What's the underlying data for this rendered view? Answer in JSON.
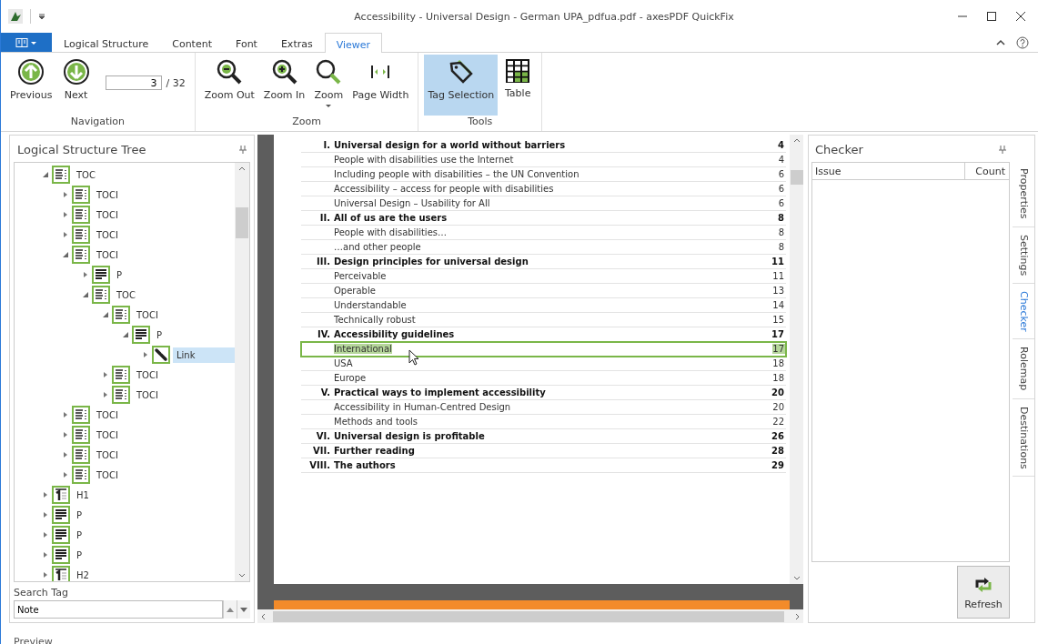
{
  "window": {
    "title": "Accessibility - Universal Design - German UPA_pdfua.pdf - axesPDF QuickFix"
  },
  "ribbon_tabs": [
    {
      "label": "Logical Structure",
      "selected": false
    },
    {
      "label": "Content",
      "selected": false
    },
    {
      "label": "Font",
      "selected": false
    },
    {
      "label": "Extras",
      "selected": false
    },
    {
      "label": "Viewer",
      "selected": true
    }
  ],
  "ribbon_groups": [
    {
      "label": "Navigation",
      "items": [
        {
          "kind": "previous",
          "label": "Previous",
          "selected": false
        },
        {
          "kind": "next",
          "label": "Next",
          "selected": false
        },
        {
          "kind": "page_field",
          "value": "3",
          "total": "/ 32"
        }
      ]
    },
    {
      "label": "Zoom",
      "items": [
        {
          "kind": "zoom_out",
          "label": "Zoom Out",
          "selected": false
        },
        {
          "kind": "zoom_in",
          "label": "Zoom In",
          "selected": false
        },
        {
          "kind": "zoom",
          "label": "Zoom",
          "selected": false
        },
        {
          "kind": "page_width",
          "label": "Page Width",
          "selected": false
        }
      ]
    },
    {
      "label": "Tools",
      "items": [
        {
          "kind": "tag",
          "label": "Tag Selection",
          "selected": true
        },
        {
          "kind": "table",
          "label": "Table",
          "selected": false
        }
      ]
    }
  ],
  "structure_panel": {
    "title": "Logical Structure Tree",
    "tree": [
      {
        "label": "TOC",
        "kind": "list",
        "expanded": true,
        "selected": false,
        "children": [
          {
            "label": "TOCI",
            "kind": "list",
            "expanded": false,
            "selected": false
          },
          {
            "label": "TOCI",
            "kind": "list",
            "expanded": false,
            "selected": false
          },
          {
            "label": "TOCI",
            "kind": "list",
            "expanded": false,
            "selected": false
          },
          {
            "label": "TOCI",
            "kind": "list",
            "expanded": true,
            "selected": false,
            "children": [
              {
                "label": "P",
                "kind": "paragraph",
                "expanded": false,
                "selected": false
              },
              {
                "label": "TOC",
                "kind": "list",
                "expanded": true,
                "selected": false,
                "children": [
                  {
                    "label": "TOCI",
                    "kind": "list",
                    "expanded": true,
                    "selected": false,
                    "children": [
                      {
                        "label": "P",
                        "kind": "paragraph",
                        "expanded": true,
                        "selected": false,
                        "children": [
                          {
                            "label": "Link",
                            "kind": "link",
                            "expanded": false,
                            "selected": true
                          }
                        ]
                      }
                    ]
                  },
                  {
                    "label": "TOCI",
                    "kind": "list",
                    "expanded": false,
                    "selected": false
                  },
                  {
                    "label": "TOCI",
                    "kind": "list",
                    "expanded": false,
                    "selected": false
                  }
                ]
              }
            ]
          },
          {
            "label": "TOCI",
            "kind": "list",
            "expanded": false,
            "selected": false
          },
          {
            "label": "TOCI",
            "kind": "list",
            "expanded": false,
            "selected": false
          },
          {
            "label": "TOCI",
            "kind": "list",
            "expanded": false,
            "selected": false
          },
          {
            "label": "TOCI",
            "kind": "list",
            "expanded": false,
            "selected": false
          }
        ]
      },
      {
        "label": "H1",
        "kind": "heading",
        "expanded": false,
        "selected": false
      },
      {
        "label": "P",
        "kind": "paragraph",
        "expanded": false,
        "selected": false
      },
      {
        "label": "P",
        "kind": "paragraph",
        "expanded": false,
        "selected": false
      },
      {
        "label": "P",
        "kind": "paragraph",
        "expanded": false,
        "selected": false
      },
      {
        "label": "H2",
        "kind": "heading",
        "expanded": false,
        "selected": false
      }
    ],
    "search_label": "Search Tag",
    "search_value": "Note"
  },
  "document": {
    "rows": [
      {
        "kind": "chapter",
        "number": "I.",
        "title": "Universal design for a world without barriers",
        "page": "4",
        "selected": false
      },
      {
        "kind": "section",
        "title": "People with disabilities use the Internet",
        "page": "4",
        "selected": false
      },
      {
        "kind": "section",
        "title": "Including people with disabilities – the UN Convention",
        "page": "6",
        "selected": false
      },
      {
        "kind": "section",
        "title": "Accessibility – access for people with disabilities",
        "page": "6",
        "selected": false
      },
      {
        "kind": "section",
        "title": "Universal Design – Usability for All",
        "page": "6",
        "selected": false
      },
      {
        "kind": "chapter",
        "number": "II.",
        "title": "All of us are the users",
        "page": "8",
        "selected": false
      },
      {
        "kind": "section",
        "title": "People with disabilities…",
        "page": "8",
        "selected": false
      },
      {
        "kind": "section",
        "title": "…and other people",
        "page": "8",
        "selected": false
      },
      {
        "kind": "chapter",
        "number": "III.",
        "title": "Design principles for universal design",
        "page": "11",
        "selected": false
      },
      {
        "kind": "section",
        "title": "Perceivable",
        "page": "11",
        "selected": false
      },
      {
        "kind": "section",
        "title": "Operable",
        "page": "13",
        "selected": false
      },
      {
        "kind": "section",
        "title": "Understandable",
        "page": "14",
        "selected": false
      },
      {
        "kind": "section",
        "title": "Technically robust",
        "page": "15",
        "selected": false
      },
      {
        "kind": "chapter",
        "number": "IV.",
        "title": "Accessibility guidelines",
        "page": "17",
        "selected": false
      },
      {
        "kind": "section",
        "title": "International",
        "page": "17",
        "selected": true
      },
      {
        "kind": "section",
        "title": "USA",
        "page": "18",
        "selected": false
      },
      {
        "kind": "section",
        "title": "Europe",
        "page": "18",
        "selected": false
      },
      {
        "kind": "chapter",
        "number": "V.",
        "title": "Practical ways to implement accessibility",
        "page": "20",
        "selected": false
      },
      {
        "kind": "section",
        "title": "Accessibility in Human-Centred Design",
        "page": "20",
        "selected": false
      },
      {
        "kind": "section",
        "title": "Methods and tools",
        "page": "22",
        "selected": false
      },
      {
        "kind": "chapter",
        "number": "VI.",
        "title": "Universal design is profitable",
        "page": "26",
        "selected": false
      },
      {
        "kind": "chapter",
        "number": "VII.",
        "title": "Further reading",
        "page": "28",
        "selected": false
      },
      {
        "kind": "chapter",
        "number": "VIII.",
        "title": "The authors",
        "page": "29",
        "selected": false
      }
    ]
  },
  "checker_panel": {
    "title": "Checker",
    "columns": [
      "Issue",
      "Count"
    ],
    "refresh_label": "Refresh"
  },
  "side_tabs": [
    {
      "label": "Properties",
      "selected": false
    },
    {
      "label": "Settings",
      "selected": false
    },
    {
      "label": "Checker",
      "selected": true
    },
    {
      "label": "Rolemap",
      "selected": false
    },
    {
      "label": "Destinations",
      "selected": false
    }
  ],
  "status_bar": {
    "text": "Preview"
  }
}
